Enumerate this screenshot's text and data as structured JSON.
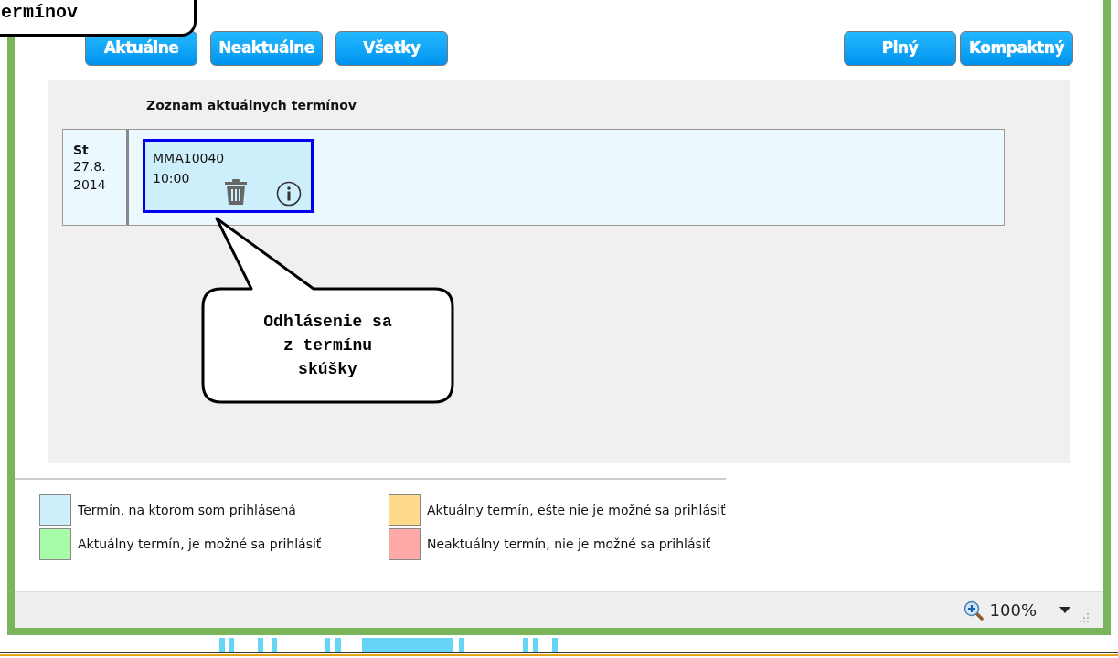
{
  "top_callout": {
    "text": "ermínov"
  },
  "filter_buttons": [
    {
      "label": "Aktuálne"
    },
    {
      "label": "Neaktuálne"
    },
    {
      "label": "Všetky"
    }
  ],
  "view_buttons": [
    {
      "label": "Plný"
    },
    {
      "label": "Kompaktný"
    }
  ],
  "list": {
    "title": "Zoznam aktuálnych termínov",
    "rows": [
      {
        "day": "St",
        "date": "27.8.",
        "year": "2014",
        "entries": [
          {
            "code": "MMA10040",
            "time": "10:00",
            "color": "#cdeffc"
          }
        ]
      }
    ]
  },
  "callout": {
    "text": "Odhlásenie sa z termínu skúšky"
  },
  "legend": [
    {
      "label": "Termín, na ktorom som prihlásená",
      "color": "#cdeffc"
    },
    {
      "label": "Aktuálny termín, ešte nie je možné sa prihlásiť",
      "color": "#fedb8b"
    },
    {
      "label": "Aktuálny termín, je možné sa prihlásiť",
      "color": "#a8fca8"
    },
    {
      "label": "Neaktuálny termín, nie je možné sa prihlásiť",
      "color": "#fea8a8"
    }
  ],
  "status_bar": {
    "zoom": "100%"
  }
}
